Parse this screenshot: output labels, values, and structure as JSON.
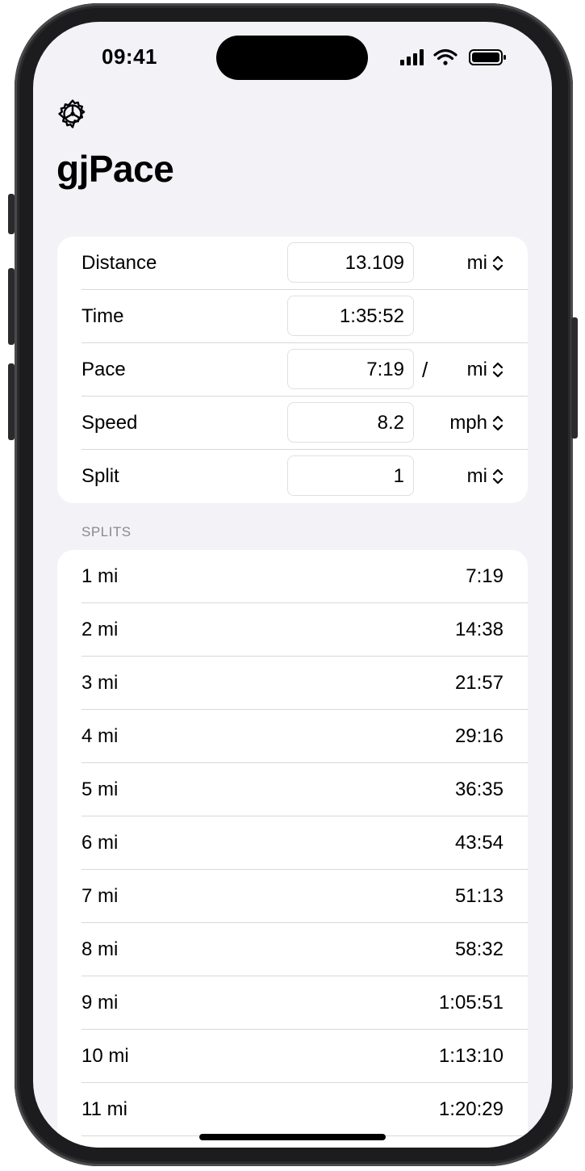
{
  "status_bar": {
    "time": "09:41"
  },
  "app": {
    "title": "gjPace"
  },
  "icons": {
    "settings": "gear-icon",
    "chevron": "chevron-up-down-icon"
  },
  "inputs": {
    "distance": {
      "label": "Distance",
      "value": "13.109",
      "unit": "mi"
    },
    "time": {
      "label": "Time",
      "value": "1:35:52"
    },
    "pace": {
      "label": "Pace",
      "value": "7:19",
      "separator": "/",
      "unit": "mi"
    },
    "speed": {
      "label": "Speed",
      "value": "8.2",
      "unit": "mph"
    },
    "split": {
      "label": "Split",
      "value": "1",
      "unit": "mi"
    }
  },
  "splits": {
    "header": "SPLITS",
    "rows": [
      {
        "label": "1 mi",
        "time": "7:19"
      },
      {
        "label": "2 mi",
        "time": "14:38"
      },
      {
        "label": "3 mi",
        "time": "21:57"
      },
      {
        "label": "4 mi",
        "time": "29:16"
      },
      {
        "label": "5 mi",
        "time": "36:35"
      },
      {
        "label": "6 mi",
        "time": "43:54"
      },
      {
        "label": "7 mi",
        "time": "51:13"
      },
      {
        "label": "8 mi",
        "time": "58:32"
      },
      {
        "label": "9 mi",
        "time": "1:05:51"
      },
      {
        "label": "10 mi",
        "time": "1:13:10"
      },
      {
        "label": "11 mi",
        "time": "1:20:29"
      }
    ]
  },
  "colors": {
    "background": "#f2f2f7",
    "card": "#ffffff",
    "text": "#000000",
    "secondary": "#8a8a8e"
  }
}
